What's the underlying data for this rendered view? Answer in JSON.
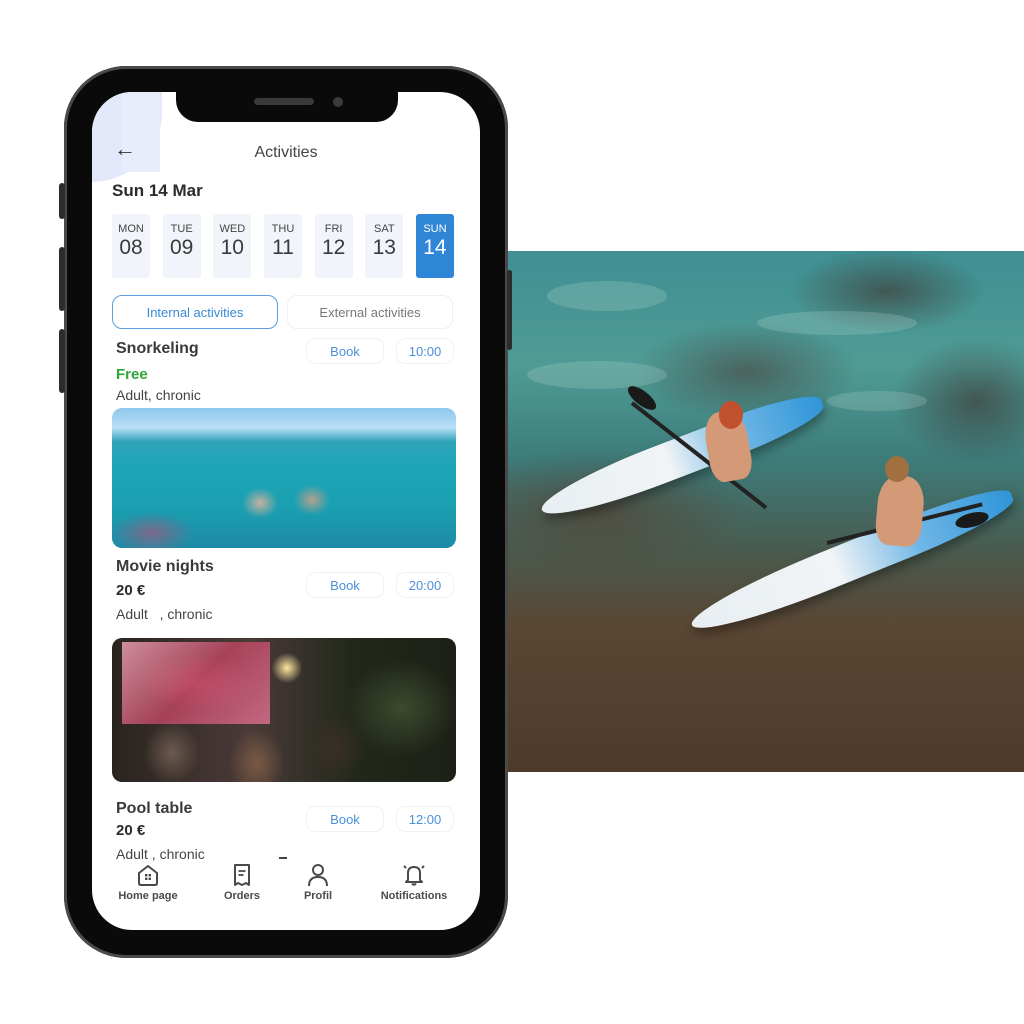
{
  "app": {
    "header": {
      "title": "Activities",
      "back_icon": "arrow-left-icon"
    },
    "date_heading": "Sun 14 Mar",
    "days": [
      {
        "name": "MON",
        "date": "08",
        "selected": false
      },
      {
        "name": "TUE",
        "date": "09",
        "selected": false
      },
      {
        "name": "WED",
        "date": "10",
        "selected": false
      },
      {
        "name": "THU",
        "date": "11",
        "selected": false
      },
      {
        "name": "FRI",
        "date": "12",
        "selected": false
      },
      {
        "name": "SAT",
        "date": "13",
        "selected": false
      },
      {
        "name": "SUN",
        "date": "14",
        "selected": true
      }
    ],
    "tabs": [
      {
        "label": "Internal activities",
        "active": true
      },
      {
        "label": "External activities",
        "active": false
      }
    ],
    "activities": [
      {
        "name": "Snorkeling",
        "price": "Free",
        "audience": "Adult, chronic",
        "book_label": "Book",
        "time": "10:00",
        "image": "snorkeling-photo"
      },
      {
        "name": "Movie nights",
        "price": "20 €",
        "audience": "Adult   , chronic",
        "book_label": "Book",
        "time": "20:00",
        "image": "movie-night-photo"
      },
      {
        "name": "Pool table",
        "price": "20 €",
        "audience": "Adult , chronic",
        "book_label": "Book",
        "time": "12:00"
      }
    ],
    "nav": [
      {
        "label": "Home page",
        "icon": "home-icon"
      },
      {
        "label": "Orders",
        "icon": "receipt-icon"
      },
      {
        "label": "Profil",
        "icon": "user-icon"
      },
      {
        "label": "Notifications",
        "icon": "bell-icon"
      }
    ]
  },
  "colors": {
    "accent": "#2f86d6",
    "free_price": "#2fa43a",
    "link_blue": "#4a90d9",
    "day_bg": "#f1f5fb"
  },
  "side_photo": {
    "subject": "kayaking-couple-photo"
  }
}
